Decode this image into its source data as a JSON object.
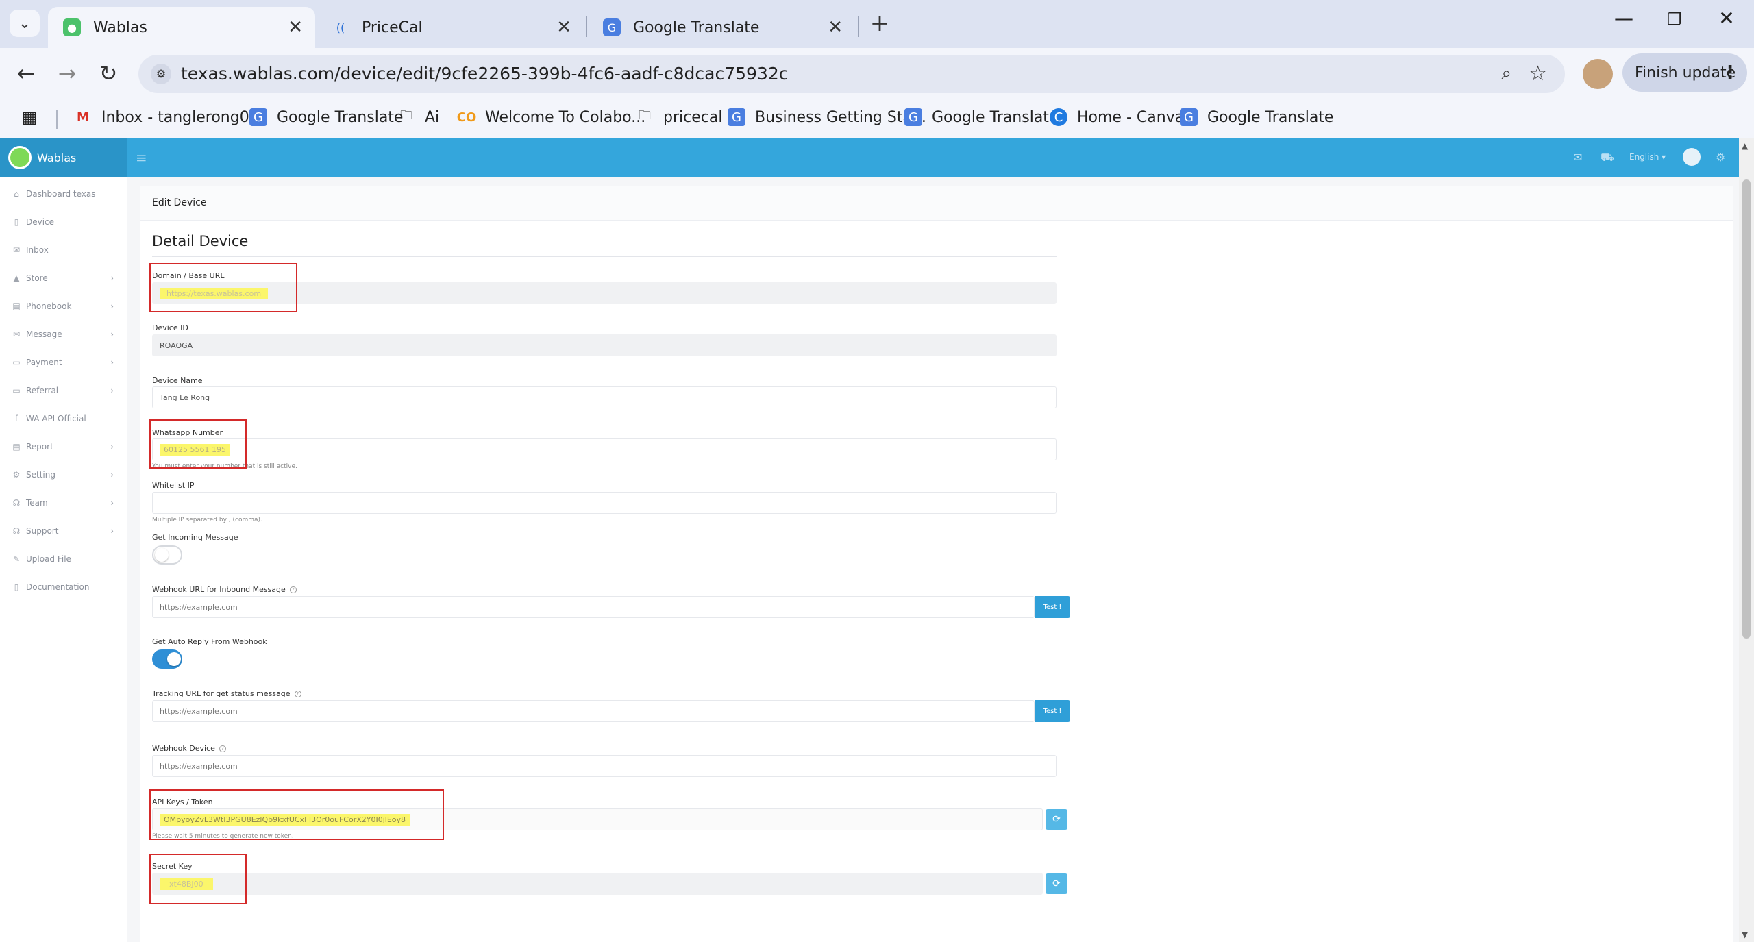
{
  "browser": {
    "tabs": [
      {
        "title": "Wablas",
        "active": true
      },
      {
        "title": "PriceCal",
        "active": false
      },
      {
        "title": "Google Translate",
        "active": false
      }
    ],
    "url": "texas.wablas.com/device/edit/9cfe2265-399b-4fc6-aadf-c8dcac75932c",
    "finish_update": "Finish update",
    "bookmarks": [
      "Inbox - tanglerong0...",
      "Google Translate",
      "Ai",
      "Welcome To Colabo...",
      "pricecal",
      "Business Getting Sta...",
      "Google Translate",
      "Home - Canva",
      "Google Translate"
    ]
  },
  "app": {
    "logo_text": "Wablas",
    "language": "English",
    "sidebar": [
      {
        "label": "Dashboard texas",
        "icon": "home-icon",
        "chevron": false
      },
      {
        "label": "Device",
        "icon": "device-icon",
        "chevron": false
      },
      {
        "label": "Inbox",
        "icon": "inbox-icon",
        "chevron": false
      },
      {
        "label": "Store",
        "icon": "store-icon",
        "chevron": true
      },
      {
        "label": "Phonebook",
        "icon": "phonebook-icon",
        "chevron": true
      },
      {
        "label": "Message",
        "icon": "message-icon",
        "chevron": true
      },
      {
        "label": "Payment",
        "icon": "payment-icon",
        "chevron": true
      },
      {
        "label": "Referral",
        "icon": "referral-icon",
        "chevron": true
      },
      {
        "label": "WA API Official",
        "icon": "facebook-icon",
        "chevron": false
      },
      {
        "label": "Report",
        "icon": "report-icon",
        "chevron": true
      },
      {
        "label": "Setting",
        "icon": "setting-icon",
        "chevron": true
      },
      {
        "label": "Team",
        "icon": "team-icon",
        "chevron": true
      },
      {
        "label": "Support",
        "icon": "support-icon",
        "chevron": true
      },
      {
        "label": "Upload File",
        "icon": "upload-icon",
        "chevron": false
      },
      {
        "label": "Documentation",
        "icon": "document-icon",
        "chevron": false
      }
    ]
  },
  "form": {
    "breadcrumb": "Edit Device",
    "section_title": "Detail Device",
    "domain_label": "Domain / Base URL",
    "domain_value": "https://texas.wablas.com",
    "device_id_label": "Device ID",
    "device_id_value": "ROAOGA",
    "device_name_label": "Device Name",
    "device_name_value": "Tang Le Rong",
    "whatsapp_label": "Whatsapp Number",
    "whatsapp_value": "60125 5561 195",
    "whatsapp_help": "You must enter your number that is still active.",
    "whitelist_label": "Whitelist IP",
    "whitelist_value": "",
    "whitelist_help": "Multiple IP separated by , (comma).",
    "incoming_label": "Get Incoming Message",
    "incoming_on": false,
    "webhook_inbound_label": "Webhook URL for Inbound Message",
    "webhook_inbound_placeholder": "https://example.com",
    "test_label": "Test !",
    "autoreply_label": "Get Auto Reply From Webhook",
    "autoreply_on": true,
    "tracking_label": "Tracking URL for get status message",
    "tracking_placeholder": "https://example.com",
    "webhook_device_label": "Webhook Device",
    "webhook_device_placeholder": "https://example.com",
    "api_label": "API Keys / Token",
    "api_value": "OMpyoyZvL3WtI3PGU8EzlQb9kxfUCxI I3Or0ouFCorX2Y0I0jlEoy8",
    "api_help": "Please wait 5 minutes to generate new token.",
    "secret_label": "Secret Key",
    "secret_value": "xt48BJ00"
  },
  "colors": {
    "brand_bar": "#34a6dc",
    "button": "#2f9fd8",
    "highlight": "#fbf66b",
    "annotation": "#d42a2a"
  }
}
